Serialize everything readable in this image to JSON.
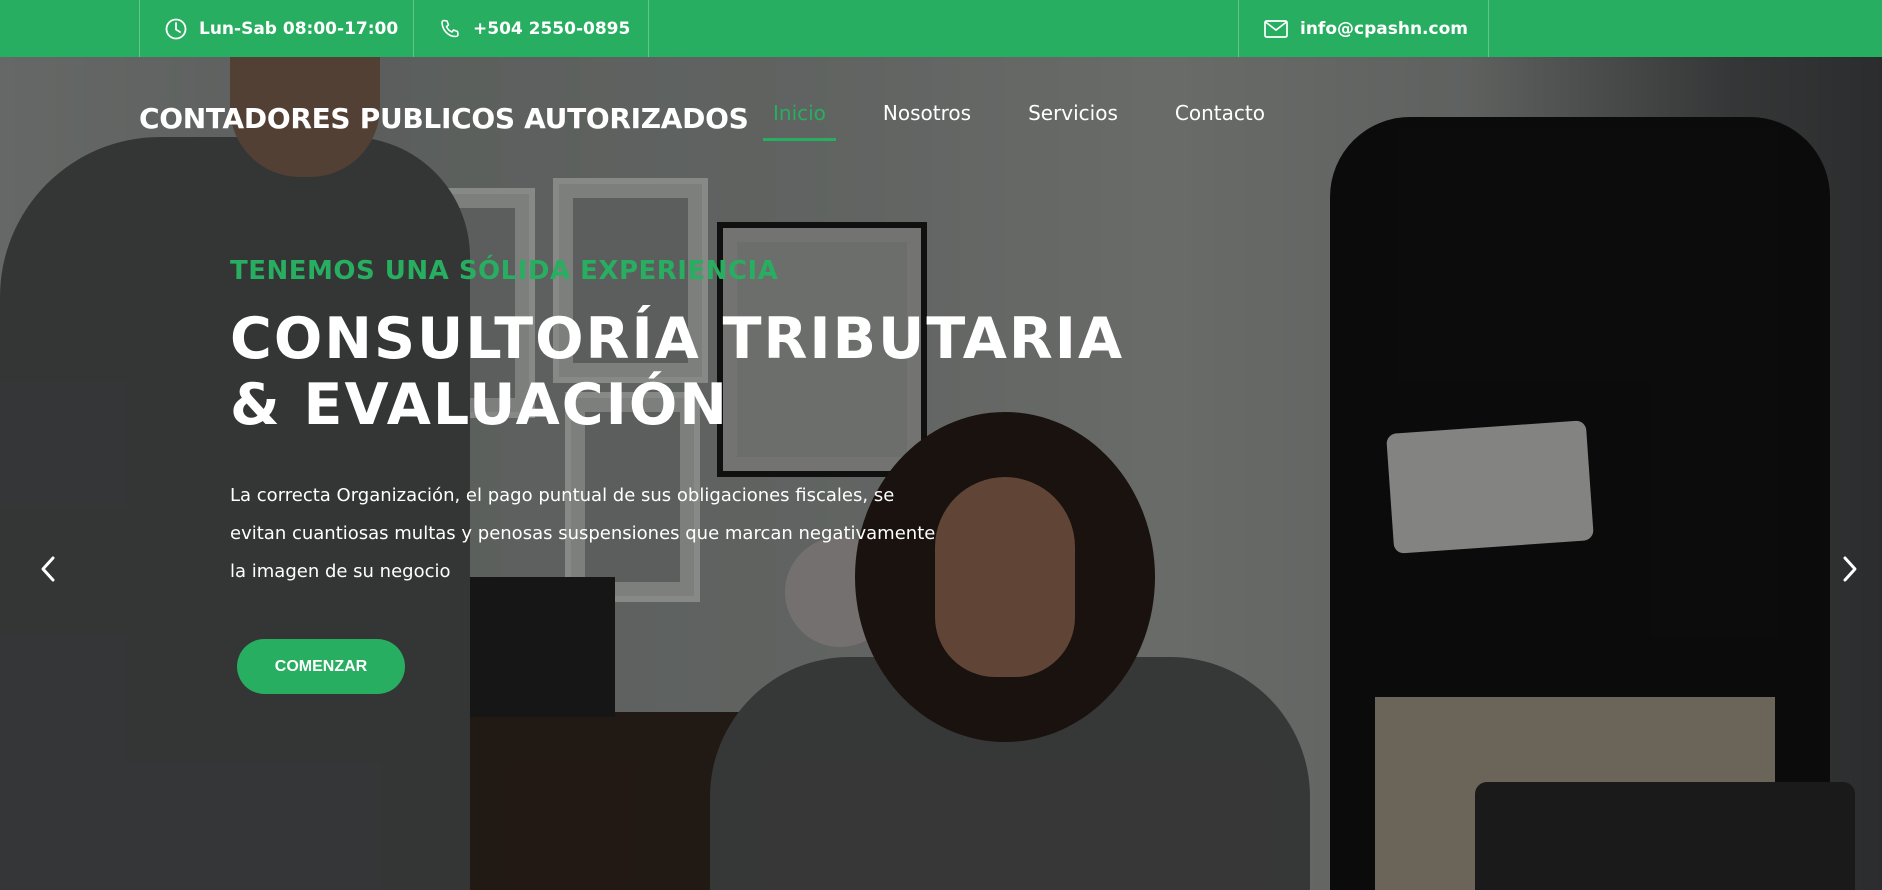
{
  "topbar": {
    "hours": "Lun-Sab 08:00-17:00",
    "phone": "+504 2550-0895",
    "email": "info@cpashn.com",
    "hours_icon": "clock-icon",
    "phone_icon": "phone-icon",
    "email_icon": "envelope-icon"
  },
  "brand": "CONTADORES PUBLICOS AUTORIZADOS",
  "nav": {
    "items": [
      {
        "label": "Inicio",
        "active": true
      },
      {
        "label": "Nosotros"
      },
      {
        "label": "Servicios"
      },
      {
        "label": "Contacto"
      }
    ]
  },
  "hero": {
    "kicker": "TENEMOS UNA SÓLIDA EXPERIENCIA",
    "headline_line1": "CONSULTORÍA TRIBUTARIA",
    "headline_line2": "& EVALUACIÓN",
    "description": "La correcta Organización, el pago puntual de sus obligaciones fiscales, se evitan cuantiosas multas y penosas suspensiones que marcan negativamente la imagen de su negocio",
    "cta_label": "COMENZAR",
    "prev_icon": "chevron-left-icon",
    "next_icon": "chevron-right-icon"
  },
  "colors": {
    "accent": "#27ae60",
    "text_light": "#ffffff"
  }
}
